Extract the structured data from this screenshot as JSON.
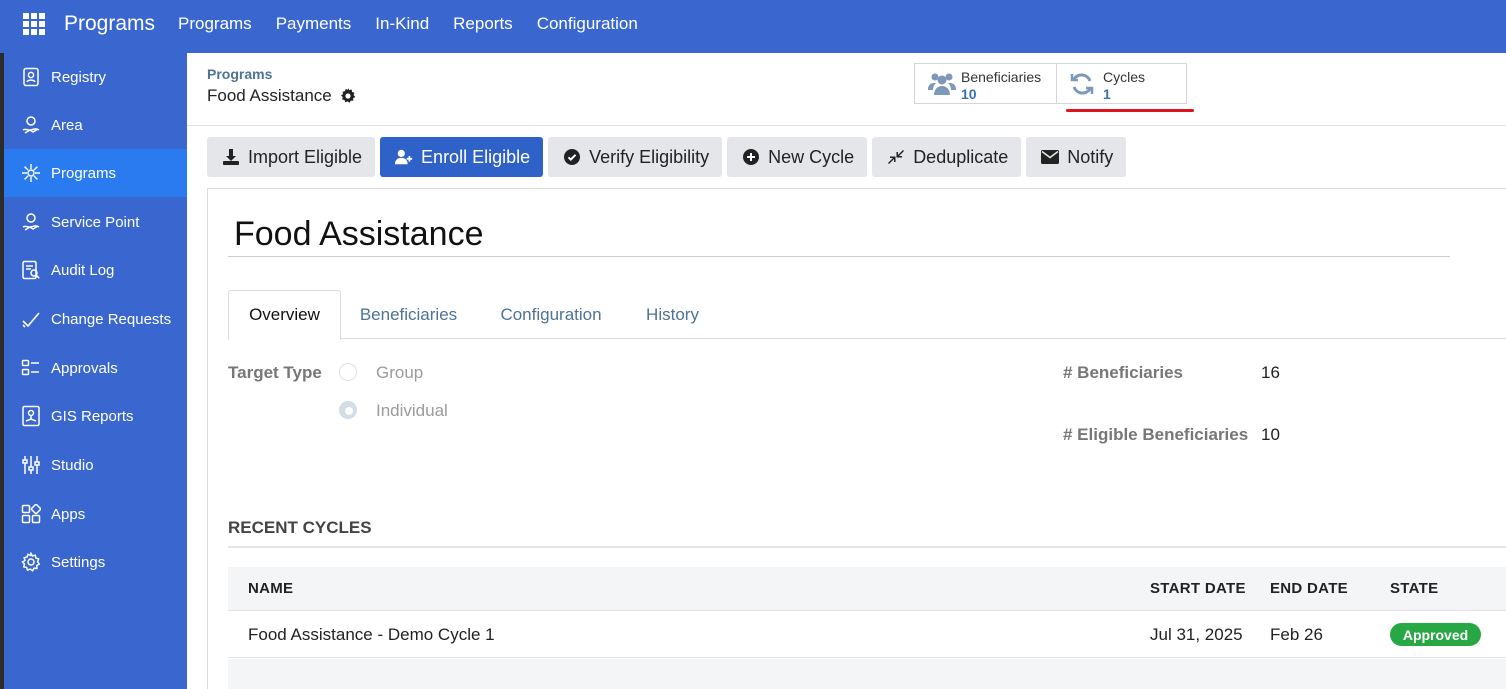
{
  "app": {
    "title": "Programs"
  },
  "topnav": [
    "Programs",
    "Payments",
    "In-Kind",
    "Reports",
    "Configuration"
  ],
  "sidebar": {
    "items": [
      {
        "label": "Registry",
        "icon": "registry-icon"
      },
      {
        "label": "Area",
        "icon": "area-icon"
      },
      {
        "label": "Programs",
        "icon": "programs-icon",
        "active": true
      },
      {
        "label": "Service Point",
        "icon": "service-point-icon"
      },
      {
        "label": "Audit Log",
        "icon": "audit-log-icon"
      },
      {
        "label": "Change Requests",
        "icon": "change-requests-icon"
      },
      {
        "label": "Approvals",
        "icon": "approvals-icon"
      },
      {
        "label": "GIS Reports",
        "icon": "gis-reports-icon"
      },
      {
        "label": "Studio",
        "icon": "studio-icon"
      },
      {
        "label": "Apps",
        "icon": "apps-icon"
      },
      {
        "label": "Settings",
        "icon": "settings-icon"
      }
    ]
  },
  "header": {
    "breadcrumb": "Programs",
    "record_title": "Food Assistance",
    "smart_buttons": [
      {
        "label": "Beneficiaries",
        "value": "10",
        "icon": "users-icon"
      },
      {
        "label": "Cycles",
        "value": "1",
        "icon": "refresh-icon"
      }
    ]
  },
  "actions": [
    {
      "label": "Import Eligible",
      "icon": "download-icon"
    },
    {
      "label": "Enroll Eligible",
      "icon": "user-plus-icon",
      "primary": true
    },
    {
      "label": "Verify Eligibility",
      "icon": "check-circle-icon"
    },
    {
      "label": "New Cycle",
      "icon": "plus-circle-icon"
    },
    {
      "label": "Deduplicate",
      "icon": "compress-icon"
    },
    {
      "label": "Notify",
      "icon": "envelope-icon"
    }
  ],
  "form": {
    "name": "Food Assistance",
    "tabs": [
      "Overview",
      "Beneficiaries",
      "Configuration",
      "History"
    ],
    "active_tab": "Overview",
    "target_type_label": "Target Type",
    "target_type_options": [
      "Group",
      "Individual"
    ],
    "target_type_selected": "Individual",
    "beneficiaries_label": "# Beneficiaries",
    "beneficiaries_value": "16",
    "eligible_label": "# Eligible Beneficiaries",
    "eligible_value": "10",
    "recent_cycles_title": "RECENT CYCLES",
    "columns": [
      "NAME",
      "START DATE",
      "END DATE",
      "STATE"
    ],
    "rows": [
      {
        "name": "Food Assistance - Demo Cycle 1",
        "start_date": "Jul 31, 2025",
        "end_date": "Feb 26",
        "state": "Approved"
      }
    ]
  },
  "colors": {
    "nav_bg": "#3a67cf",
    "active_item": "#2b7bf0",
    "primary_button": "#2f62c8",
    "approved_badge": "#28a745",
    "highlight_underline": "#e0121e"
  }
}
